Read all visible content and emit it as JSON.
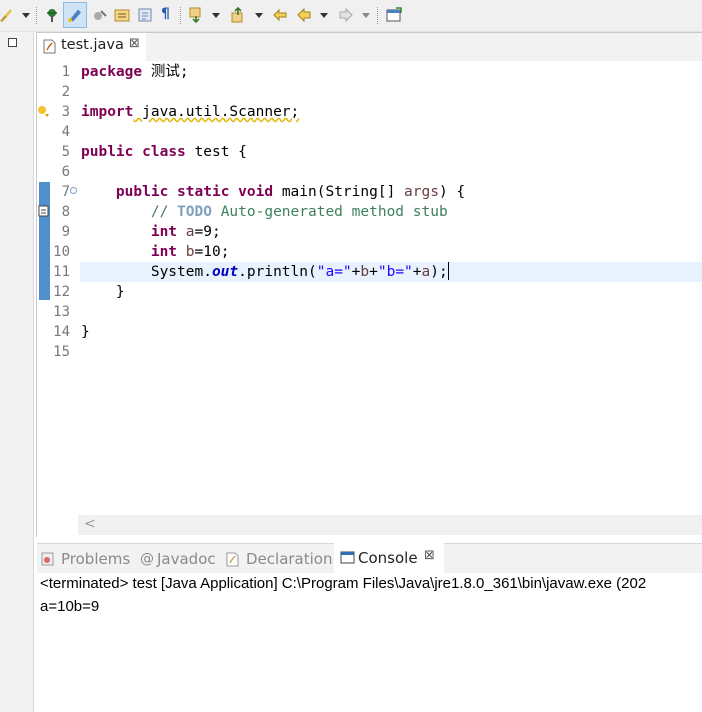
{
  "editor": {
    "tab_label": "test.java",
    "tab_close": "⊠",
    "line_numbers": [
      "1",
      "2",
      "3",
      "4",
      "5",
      "6",
      "7",
      "8",
      "9",
      "10",
      "11",
      "12",
      "13",
      "14",
      "15"
    ],
    "lines": {
      "l1_kw": "package",
      "l1_rest": " 测试;",
      "l3_kw": "import",
      "l3_rest": " java.util.Scanner;",
      "l5_kw1": "public",
      "l5_kw2": "class",
      "l5_rest": " test {",
      "l7_kw1": "public",
      "l7_kw2": "static",
      "l7_kw3": "void",
      "l7_mid": " main(String[] ",
      "l7_var": "args",
      "l7_end": ") {",
      "l8_c1": "// ",
      "l8_todo": "TODO",
      "l8_c2": " Auto-generated method stub",
      "l9_kw": "int",
      "l9_var": "a",
      "l9_rest": "=9;",
      "l10_kw": "int",
      "l10_var": "b",
      "l10_rest": "=10;",
      "l11_a": "System.",
      "l11_out": "out",
      "l11_b": ".println(",
      "l11_s1": "\"a=\"",
      "l11_c": "+",
      "l11_v1": "b",
      "l11_d": "+",
      "l11_s2": "\"b=\"",
      "l11_e": "+",
      "l11_v2": "a",
      "l11_f": ");",
      "l12": "}",
      "l14": "}"
    },
    "hscroll_arrow": "<"
  },
  "panel": {
    "tabs": [
      "Problems",
      "Javadoc",
      "Declaration"
    ],
    "active_tab": "Console",
    "close": "⊠",
    "status": "<terminated> test [Java Application] C:\\Program Files\\Java\\jre1.8.0_361\\bin\\javaw.exe  (202",
    "output": "a=10b=9"
  },
  "colors": {
    "keyword": "#7f0055",
    "comment": "#3f7f5f",
    "string": "#2a00ff",
    "current_line": "#e8f2fe"
  },
  "icons": [
    "brush-icon",
    "pin-icon",
    "highlight-pen-icon",
    "format-icon",
    "toggle-icon",
    "pilcrow-icon",
    "next-annotation-icon",
    "previous-annotation-icon",
    "back-icon",
    "forward-icon",
    "open-console-icon",
    "minimize-icon",
    "java-file-icon",
    "problems-icon",
    "javadoc-icon",
    "declaration-icon",
    "console-icon"
  ]
}
